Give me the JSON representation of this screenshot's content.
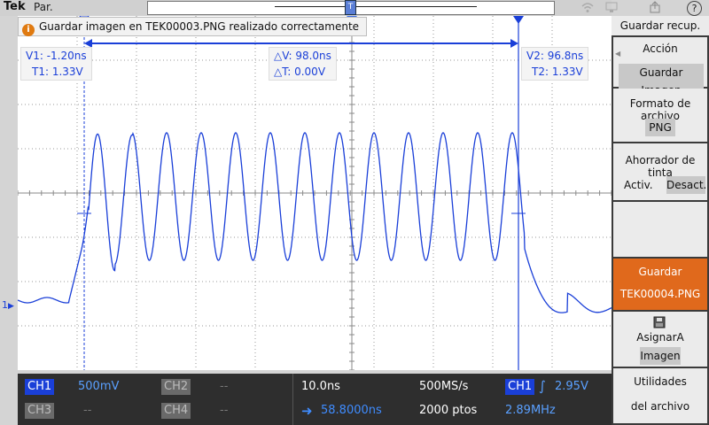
{
  "topbar": {
    "logo": "Tek",
    "mode": "Par.",
    "trigger_marker": "T",
    "icons": [
      "wifi-icon",
      "network-icon",
      "usb-icon",
      "help-icon"
    ],
    "help_glyph": "?"
  },
  "message": {
    "icon": "i",
    "text": "Guardar imagen en TEK00003.PNG realizado correctamente"
  },
  "cursors": {
    "v1": "V1: -1.20ns",
    "t1": "T1: 1.33V",
    "delta_v": "△V: 98.0ns",
    "delta_t": "△T: 0.00V",
    "v2": "V2: 96.8ns",
    "t2": "T2: 1.33V",
    "channel_marker": "1"
  },
  "status": {
    "ch1": {
      "label": "CH1",
      "value": "500mV"
    },
    "ch2": {
      "label": "CH2",
      "value": "--"
    },
    "ch3": {
      "label": "CH3",
      "value": "--"
    },
    "ch4": {
      "label": "CH4",
      "value": "--"
    },
    "timebase": "10.0ns",
    "position": "58.8000ns",
    "sample_rate": "500MS/s",
    "record_length": "2000 ptos",
    "trigger_channel": "CH1",
    "trigger_level": "2.95V",
    "frequency": "2.89MHz",
    "colors": {
      "ch1": "#1a3fd8",
      "position": "#2f7ff0",
      "inactive": "#555555"
    }
  },
  "menu": {
    "title": "Guardar recup.",
    "action_label": "Acción",
    "action_value": "Guardar Imagen",
    "format_label": "Formato de archivo",
    "format_value": "PNG",
    "ink_label": "Ahorrador de tinta",
    "ink_on": "Activ.",
    "ink_off": "Desact.",
    "save_label": "Guardar",
    "save_file": "TEK00004.PNG",
    "assign_label": "AsignarA",
    "assign_value": "Imagen",
    "utils_line1": "Utilidades",
    "utils_line2": "del archivo",
    "accent": "#e0691c"
  }
}
